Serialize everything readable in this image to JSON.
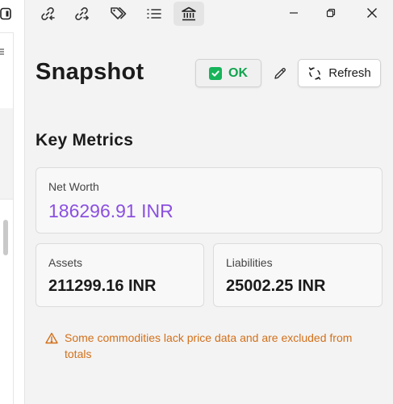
{
  "window": {
    "minimize_label": "Minimize",
    "maximize_label": "Restore",
    "close_label": "Close"
  },
  "toolbar": {
    "icons": [
      "link-in-icon",
      "link-out-icon",
      "tags-icon",
      "list-icon",
      "bank-icon"
    ],
    "active_icon": "bank-icon"
  },
  "header": {
    "title": "Snapshot",
    "ok_label": "OK",
    "refresh_label": "Refresh"
  },
  "section": {
    "title": "Key Metrics"
  },
  "metrics": {
    "net_worth": {
      "label": "Net Worth",
      "value": "186296.91 INR"
    },
    "assets": {
      "label": "Assets",
      "value": "211299.16 INR"
    },
    "liabilities": {
      "label": "Liabilities",
      "value": "25002.25 INR"
    }
  },
  "warning": {
    "text": "Some commodities lack price data and are excluded from totals"
  },
  "colors": {
    "accent_purple": "#8b50e0",
    "ok_green": "#17b45a",
    "warning_orange": "#d2701a"
  }
}
